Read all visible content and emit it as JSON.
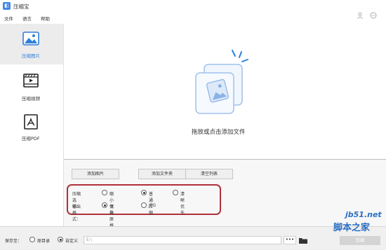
{
  "app": {
    "title": "压缩宝",
    "icon": "app-logo-icon"
  },
  "menu": [
    "文件",
    "语言",
    "帮助"
  ],
  "topright_icons": [
    "user-icon",
    "chat-icon"
  ],
  "sidebar": {
    "items": [
      {
        "label": "压缩图片",
        "icon": "image-icon",
        "active": true
      },
      {
        "label": "压缩视频",
        "icon": "video-icon",
        "active": false
      },
      {
        "label": "压缩PDF",
        "icon": "pdf-icon",
        "active": false
      }
    ]
  },
  "dropzone": {
    "text": "拖放或点击添加文件"
  },
  "buttons": {
    "add_image": "添加图片",
    "add_folder": "添加文件夹",
    "clear_list": "清空列表"
  },
  "options": {
    "compress_label": "压缩选项：",
    "compress_choices": [
      {
        "label": "缩小优先",
        "selected": false
      },
      {
        "label": "普通压缩",
        "selected": true
      },
      {
        "label": "清晰优先",
        "selected": false
      }
    ],
    "output_label": "输出格式：",
    "output_choices": [
      {
        "label": "保持原格式",
        "selected": true
      },
      {
        "label": "JPG",
        "selected": false
      }
    ]
  },
  "footer": {
    "save_to_label": "保存至：",
    "save_choices": [
      {
        "label": "原目录",
        "selected": false
      },
      {
        "label": "自定义",
        "selected": true
      }
    ],
    "path_value": "E:\\",
    "more_label": "•••",
    "compress_button": "压缩"
  },
  "watermark": {
    "url": "jb51.net",
    "text": "脚本之家"
  },
  "colors": {
    "accent": "#3f87e8",
    "highlight_frame": "#b0303a",
    "sidebar_active": "#ececec"
  }
}
